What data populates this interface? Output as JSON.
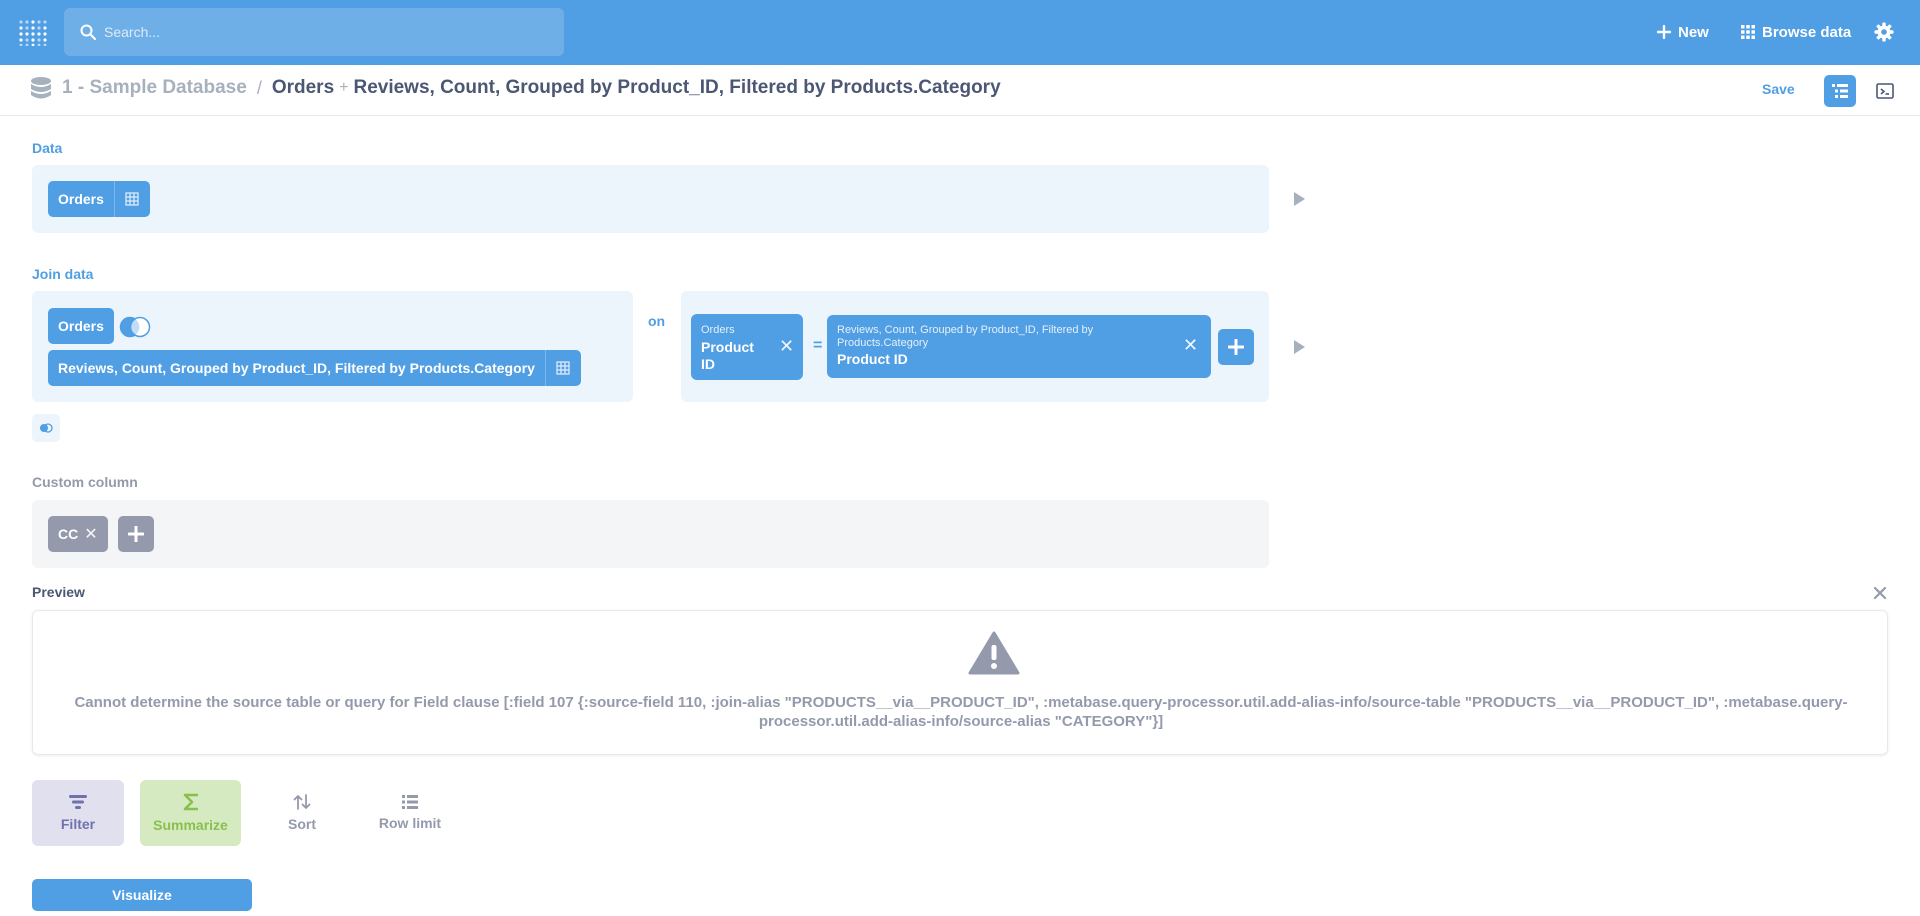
{
  "nav": {
    "search_placeholder": "Search...",
    "new_label": "New",
    "browse_label": "Browse data",
    "icons": [
      "metabase-logo-icon",
      "search-icon",
      "plus-icon",
      "grid-icon",
      "gear-icon"
    ]
  },
  "header": {
    "database": "1 - Sample Database",
    "separator": "/",
    "base_table": "Orders",
    "plus": "+",
    "joined_table": "Reviews, Count, Grouped by Product_ID, Filtered by Products.Category",
    "save_label": "Save"
  },
  "data_step": {
    "label": "Data",
    "table": "Orders"
  },
  "join_step": {
    "label": "Join data",
    "left_table": "Orders",
    "right_table": "Reviews, Count, Grouped by Product_ID, Filtered by Products.Category",
    "on_label": "on",
    "left_column": {
      "table": "Orders",
      "field": "Product ID"
    },
    "operator": "=",
    "right_column": {
      "table": "Reviews, Count, Grouped by Product_ID, Filtered by Products.Category",
      "field": "Product ID"
    }
  },
  "custom_column_step": {
    "label": "Custom column",
    "columns": [
      "CC"
    ]
  },
  "preview": {
    "label": "Preview",
    "error": "Cannot determine the source table or query for Field clause [:field 107 {:source-field 110, :join-alias \"PRODUCTS__via__PRODUCT_ID\", :metabase.query-processor.util.add-alias-info/source-table \"PRODUCTS__via__PRODUCT_ID\", :metabase.query-processor.util.add-alias-info/source-alias \"CATEGORY\"}]"
  },
  "actions": {
    "filter": "Filter",
    "summarize": "Summarize",
    "sort": "Sort",
    "row_limit": "Row limit",
    "visualize": "Visualize"
  },
  "colors": {
    "brand": "#509ee3",
    "filter": "#7172ad",
    "summarize": "#88bf4d",
    "text_light": "#949aab"
  }
}
